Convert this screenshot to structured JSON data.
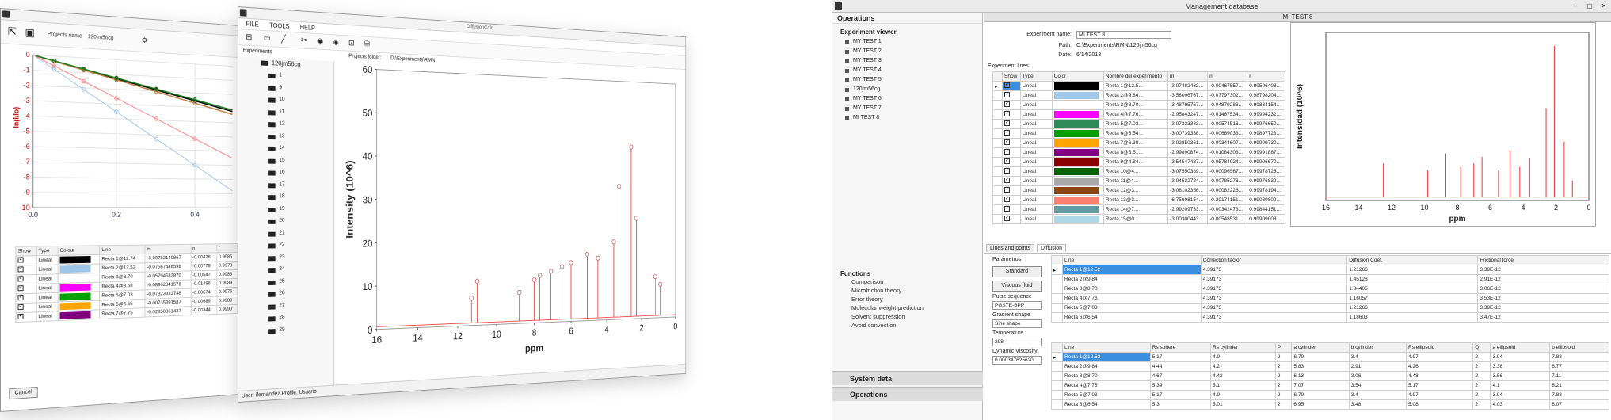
{
  "left_window": {
    "project_label": "Projects name",
    "project_value": "120jm56cg",
    "y_axis_label": "ln(I/Io)",
    "y_ticks": [
      "0",
      "-1",
      "-2",
      "-3",
      "-4",
      "-5",
      "-6",
      "-7",
      "-8",
      "-9",
      "-10"
    ],
    "x_ticks": [
      "0.0",
      "0.2",
      "0.4"
    ],
    "table_headers": [
      "Show",
      "Type",
      "Colour",
      "Line",
      "m",
      "n",
      "r"
    ],
    "rows": [
      {
        "type": "Lineal",
        "line": "Recta 1@12.74",
        "m": "-0.00782149867",
        "n": "-0.00476",
        "r": "0.9985",
        "color": "#000000"
      },
      {
        "type": "Lineal",
        "line": "Recta 2@12.52",
        "m": "-0.07567446598",
        "n": "-0.00779",
        "r": "0.9978",
        "color": "#9fc5e8"
      },
      {
        "type": "Lineal",
        "line": "Recta 3@8.70",
        "m": "-0.05794532870",
        "n": "-0.00547",
        "r": "0.9983",
        "color": "#ffffff"
      },
      {
        "type": "Lineal",
        "line": "Recta 4@8.68",
        "m": "-0.08962841576",
        "n": "-0.01496",
        "r": "0.9989",
        "color": "#ff00ff"
      },
      {
        "type": "Lineal",
        "line": "Recta 5@7.03",
        "m": "-0.07323333748",
        "n": "-0.00574",
        "r": "0.9976",
        "color": "#00a000"
      },
      {
        "type": "Lineal",
        "line": "Recta 6@6.55",
        "m": "-0.00735391587",
        "n": "-0.00689",
        "r": "0.9989",
        "color": "#ffa500"
      },
      {
        "type": "Lineal",
        "line": "Recta 7@7.75",
        "m": "-0.02850361437",
        "n": "-0.00344",
        "r": "0.9990",
        "color": "#800080"
      }
    ],
    "cancel_label": "Cancel"
  },
  "middle_window": {
    "title": "DiffusionCalc",
    "menu": [
      "FILE",
      "TOOLS",
      "HELP"
    ],
    "experiments_label": "Experiments",
    "project_folder_label": "Projects folder:",
    "project_folder_value": "D:\\Experiments\\RMN",
    "tree_root": "120jm56cg",
    "tree_items": [
      "1",
      "9",
      "10",
      "11",
      "12",
      "13",
      "14",
      "15",
      "16",
      "17",
      "18",
      "19",
      "20",
      "21",
      "22",
      "23",
      "24",
      "25",
      "26",
      "27",
      "28",
      "29"
    ],
    "status_user_label": "User:",
    "status_user_value": "ifernandez",
    "status_profile_label": "Profile:",
    "status_profile_value": "Usuario"
  },
  "management": {
    "window_title": "Management database",
    "operations_title": "Operations",
    "experiment_viewer_title": "Experiment viewer",
    "experiments": [
      "MY TEST 1",
      "MY TEST 2",
      "MY TEST 3",
      "MY TEST 4",
      "MY TEST 5",
      "120jm56cg",
      "MY TEST 6",
      "MY TEST 7",
      "MI TEST 8"
    ],
    "functions_title": "Functions",
    "functions": [
      "Comparison",
      "Microfriction theory",
      "Error theory",
      "Molecular weight prediction",
      "Solvent suppression",
      "Avoid convection"
    ],
    "system_data_label": "System data",
    "operations_label": "Operations",
    "experiment_header": "MI TEST 8",
    "exp_name_label": "Experiment name:",
    "exp_name_value": "MI TEST 8",
    "path_label": "Path:",
    "path_value": "C:\\Experiments\\RMN\\120jm56cg",
    "date_label": "Date:",
    "date_value": "6/14/2013",
    "lines_label": "Experiment lines",
    "lines_headers": [
      "Show",
      "Type",
      "Color",
      "Nombre del experimento",
      "m",
      "n",
      "r"
    ],
    "lines": [
      {
        "type": "Lineal",
        "color": "#000000",
        "name": "Recta 1@12.5...",
        "m": "-3.07482482...",
        "n": "-0.00467557...",
        "r": "0.99506403..."
      },
      {
        "type": "Lineal",
        "color": "#9fc5e8",
        "name": "Recta 2@9.84...",
        "m": "-3.58096767...",
        "n": "-0.07797302...",
        "r": "0.98798204..."
      },
      {
        "type": "Lineal",
        "color": "#ffffff",
        "name": "Recta 3@8.70...",
        "m": "-3.48795767...",
        "n": "-0.04879283...",
        "r": "0.99834154..."
      },
      {
        "type": "Lineal",
        "color": "#ff00ff",
        "name": "Recta 4@7.76...",
        "m": "-2.95843247...",
        "n": "-0.01467534...",
        "r": "0.99994232..."
      },
      {
        "type": "Lineal",
        "color": "#2e8b57",
        "name": "Recta 5@7.03...",
        "m": "-3.07323333...",
        "n": "-0.00574516...",
        "r": "0.99976650..."
      },
      {
        "type": "Lineal",
        "color": "#00a000",
        "name": "Recta 6@6.54...",
        "m": "-3.00739338...",
        "n": "-0.00689033...",
        "r": "0.99897723..."
      },
      {
        "type": "Lineal",
        "color": "#ffa500",
        "name": "Recta 7@6.30...",
        "m": "-3.02850361...",
        "n": "-0.00344607...",
        "r": "0.99909730..."
      },
      {
        "type": "Lineal",
        "color": "#800080",
        "name": "Recta 8@5.51...",
        "m": "-2.99890874...",
        "n": "-0.01084303...",
        "r": "0.99991887..."
      },
      {
        "type": "Lineal",
        "color": "#8b0000",
        "name": "Recta 9@4.84...",
        "m": "-3.54547487...",
        "n": "-0.05784024...",
        "r": "0.99906670..."
      },
      {
        "type": "Lineal",
        "color": "#006400",
        "name": "Recta 10@4...",
        "m": "-3.07550389...",
        "n": "-0.00096567...",
        "r": "0.99978726..."
      },
      {
        "type": "Lineal",
        "color": "#a9a9a9",
        "name": "Recta 11@4...",
        "m": "-3.04532724...",
        "n": "-0.00785276...",
        "r": "0.99976832..."
      },
      {
        "type": "Lineal",
        "color": "#8b4513",
        "name": "Recta 12@3...",
        "m": "-3.08102356...",
        "n": "-0.00082226...",
        "r": "0.99978194..."
      },
      {
        "type": "Lineal",
        "color": "#fa8072",
        "name": "Recta 13@3...",
        "m": "-6.75608154...",
        "n": "-0.20174151...",
        "r": "0.99039802..."
      },
      {
        "type": "Lineal",
        "color": "#5f9ea0",
        "name": "Recta 14@7...",
        "m": "-2.99209733...",
        "n": "-0.00342473...",
        "r": "0.99844151..."
      },
      {
        "type": "Lineal",
        "color": "#add8e6",
        "name": "Recta 15@0...",
        "m": "-3.00300443...",
        "n": "-0.00548531...",
        "r": "0.99909003..."
      }
    ],
    "tabs": [
      "Lines and points",
      "Diffusion"
    ],
    "parameters_label": "Parámetros",
    "standard_label": "Standard",
    "viscous_label": "Viscous fluid",
    "pulse_label": "Pulse sequence",
    "pulse_value": "PGSTE-BPP",
    "gradient_label": "Gradient shape",
    "gradient_value": "Sine shape",
    "temperature_label": "Temperature",
    "temperature_value": "298",
    "viscosity_label": "Dynamic Viscosity",
    "viscosity_value": "0.000347625620",
    "diff_headers": [
      "Line",
      "Correction factor",
      "Diffusion Coef.",
      "Frictional force"
    ],
    "diff_rows": [
      {
        "line": "Recta 1@12.52",
        "cf": "4.39173",
        "dc": "1.21266",
        "ff": "3.39E-12"
      },
      {
        "line": "Recta 2@9.84",
        "cf": "4.39173",
        "dc": "1.45128",
        "ff": "2.91E-12"
      },
      {
        "line": "Recta 3@8.70",
        "cf": "4.39173",
        "dc": "1.34405",
        "ff": "3.06E-12"
      },
      {
        "line": "Recta 4@7.76",
        "cf": "4.39173",
        "dc": "1.16057",
        "ff": "3.53E-12"
      },
      {
        "line": "Recta 5@7.03",
        "cf": "4.39173",
        "dc": "1.21266",
        "ff": "3.39E-12"
      },
      {
        "line": "Recta 6@6.54",
        "cf": "4.39173",
        "dc": "1.18603",
        "ff": "3.47E-12"
      }
    ],
    "shape_headers": [
      "Line",
      "Rs sphere",
      "Rs cylinder",
      "P",
      "a cylinder",
      "b cylinder",
      "Rs ellipsoid",
      "Q",
      "a ellipsoid",
      "b ellipsoid"
    ],
    "shape_rows": [
      {
        "line": "Recta 1@12.52",
        "rs": "5.17",
        "rc": "4.9",
        "p": "2",
        "ac": "6.79",
        "bc": "3.4",
        "re": "4.97",
        "q": "2",
        "ae": "3.94",
        "be": "7.88"
      },
      {
        "line": "Recta 2@9.84",
        "rs": "4.44",
        "rc": "4.2",
        "p": "2",
        "ac": "5.83",
        "bc": "2.91",
        "re": "4.26",
        "q": "2",
        "ae": "3.38",
        "be": "6.77"
      },
      {
        "line": "Recta 3@8.70",
        "rs": "4.67",
        "rc": "4.42",
        "p": "2",
        "ac": "6.13",
        "bc": "3.06",
        "re": "4.48",
        "q": "2",
        "ae": "3.56",
        "be": "7.11"
      },
      {
        "line": "Recta 4@7.76",
        "rs": "5.39",
        "rc": "5.1",
        "p": "2",
        "ac": "7.07",
        "bc": "3.54",
        "re": "5.17",
        "q": "2",
        "ae": "4.1",
        "be": "8.21"
      },
      {
        "line": "Recta 5@7.03",
        "rs": "5.17",
        "rc": "4.9",
        "p": "2",
        "ac": "6.79",
        "bc": "3.4",
        "re": "4.97",
        "q": "2",
        "ae": "3.94",
        "be": "7.88"
      },
      {
        "line": "Recta 6@6.54",
        "rs": "5.3",
        "rc": "5.01",
        "p": "2",
        "ac": "6.95",
        "bc": "3.48",
        "re": "5.08",
        "q": "2",
        "ae": "4.03",
        "be": "8.07"
      }
    ]
  },
  "chart_data": [
    {
      "type": "line",
      "ylabel": "ln(I/Io)",
      "ylim": [
        -10,
        0
      ],
      "xlim": [
        0,
        0.5
      ],
      "grid": true,
      "series": [
        {
          "x": [
            0,
            0.5
          ],
          "values": [
            0,
            -3.2
          ]
        },
        {
          "x": [
            0,
            0.5
          ],
          "values": [
            0,
            -3.4
          ]
        },
        {
          "x": [
            0,
            0.5
          ],
          "values": [
            0,
            -3.1
          ]
        },
        {
          "x": [
            0,
            0.5
          ],
          "values": [
            0,
            -6.5
          ]
        },
        {
          "x": [
            0,
            0.5
          ],
          "values": [
            0,
            -8.8
          ]
        }
      ]
    },
    {
      "type": "line",
      "ylabel": "Intensity (10^6)",
      "xlabel": "ppm",
      "ylim": [
        0,
        60
      ],
      "xlim": [
        16,
        0
      ],
      "y_ticks": [
        0,
        10,
        20,
        30,
        40,
        50,
        60
      ],
      "x_ticks": [
        16,
        14,
        12,
        10,
        8,
        6,
        4,
        2,
        0
      ],
      "grid": false,
      "peaks": [
        {
          "x": 11.3,
          "y": 6
        },
        {
          "x": 11.0,
          "y": 10
        },
        {
          "x": 8.8,
          "y": 7
        },
        {
          "x": 8.0,
          "y": 10
        },
        {
          "x": 7.7,
          "y": 11
        },
        {
          "x": 7.1,
          "y": 12
        },
        {
          "x": 6.5,
          "y": 13
        },
        {
          "x": 6.0,
          "y": 14
        },
        {
          "x": 5.1,
          "y": 16
        },
        {
          "x": 4.5,
          "y": 15
        },
        {
          "x": 3.6,
          "y": 19
        },
        {
          "x": 3.3,
          "y": 33
        },
        {
          "x": 2.6,
          "y": 43
        },
        {
          "x": 2.3,
          "y": 25
        },
        {
          "x": 1.2,
          "y": 10
        },
        {
          "x": 0.9,
          "y": 8
        }
      ]
    },
    {
      "type": "line",
      "ylabel": "Intensidad (10^6)",
      "xlabel": "ppm",
      "xlim": [
        16,
        0
      ],
      "x_ticks": [
        16,
        14,
        12,
        10,
        8,
        6,
        4,
        2,
        0
      ],
      "grid": false,
      "peaks": [
        {
          "x": 12.5,
          "y": 0.22
        },
        {
          "x": 9.8,
          "y": 0.18
        },
        {
          "x": 8.7,
          "y": 0.28
        },
        {
          "x": 7.8,
          "y": 0.2
        },
        {
          "x": 7.0,
          "y": 0.22
        },
        {
          "x": 6.5,
          "y": 0.26
        },
        {
          "x": 5.5,
          "y": 0.18
        },
        {
          "x": 4.8,
          "y": 0.3
        },
        {
          "x": 4.2,
          "y": 0.2
        },
        {
          "x": 3.6,
          "y": 0.25
        },
        {
          "x": 2.6,
          "y": 0.55
        },
        {
          "x": 2.1,
          "y": 0.92
        },
        {
          "x": 1.5,
          "y": 0.35
        },
        {
          "x": 1.0,
          "y": 0.12
        }
      ]
    }
  ]
}
